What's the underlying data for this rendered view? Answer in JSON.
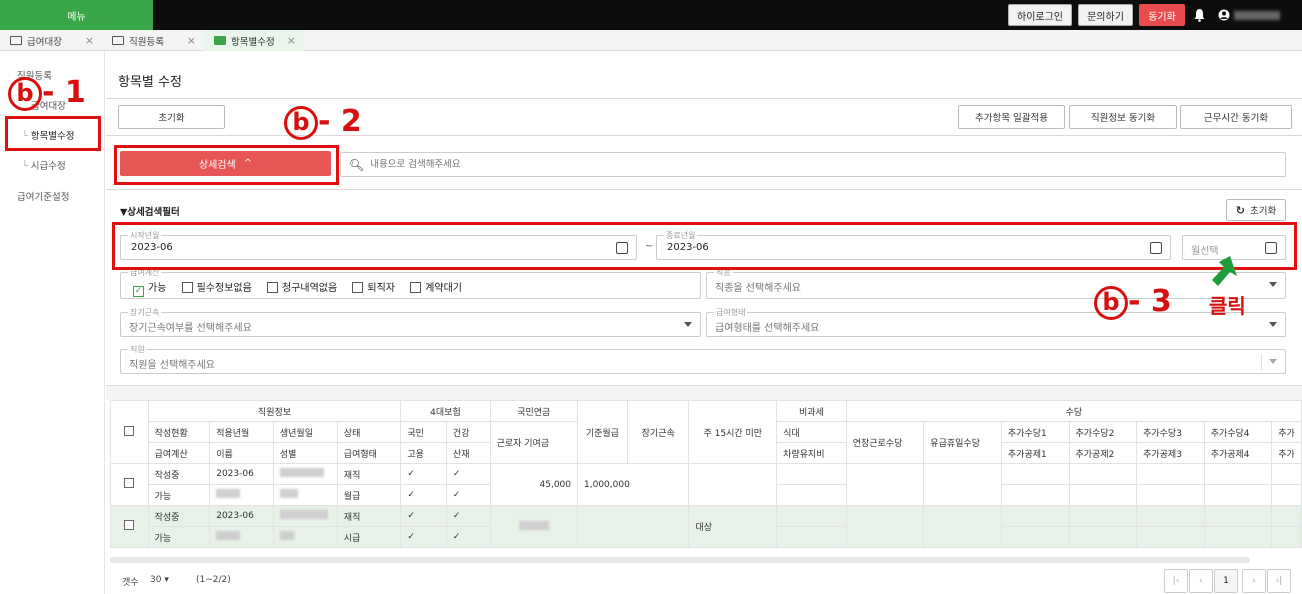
{
  "topbar": {
    "menu_label": "메뉴",
    "btn_hi": "하이로그인",
    "btn_inquiry": "문의하기",
    "btn_sync": "동기화",
    "bell_icon": "bell-icon",
    "user_icon": "user-icon"
  },
  "tabs": [
    {
      "label": "급여대장",
      "icon": "list-icon"
    },
    {
      "label": "직원등록",
      "icon": "id-card-icon"
    },
    {
      "label": "항목별수정",
      "icon": "money-icon"
    }
  ],
  "tab_close": "×",
  "sidebar": {
    "items": [
      "직원등록",
      "급여대장",
      "항목별수정",
      "시급수정",
      "급여기준설정"
    ]
  },
  "annotations": {
    "b": "b",
    "n1": "- 1",
    "n2": "- 2",
    "n3": "- 3",
    "click": "클릭",
    "color": "#e01010",
    "arrow_color": "#1f9d3a"
  },
  "page": {
    "title": "항목별 수정",
    "reset_btn": "초기화",
    "btn_add_items": "추가항목 일괄적용",
    "btn_emp_sync": "직원정보 동기화",
    "btn_work_sync": "근무시간 동기화",
    "detail_search": "상세검색",
    "search_placeholder": "내용으로 검색해주세요",
    "filter_title": "▼상세검색필터",
    "filter_reset": "초기화"
  },
  "filters": {
    "start_label": "시작년월",
    "start_value": "2023-06",
    "tilde": "~",
    "end_label": "종료년월",
    "end_value": "2023-06",
    "month_placeholder": "월선택",
    "calc_label": "급여계산",
    "checks": [
      {
        "label": "가능",
        "checked": true
      },
      {
        "label": "필수정보없음",
        "checked": false
      },
      {
        "label": "청구내역없음",
        "checked": false
      },
      {
        "label": "퇴직자",
        "checked": false
      },
      {
        "label": "계약대기",
        "checked": false
      }
    ],
    "job_label": "직종",
    "job_placeholder": "직종을 선택해주세요",
    "long_label": "장기근속",
    "long_placeholder": "장기근속여부를 선택해주세요",
    "paytype_label": "급여형태",
    "paytype_placeholder": "급여형태를 선택해주세요",
    "emp_label": "직원",
    "emp_placeholder": "직원을 선택해주세요"
  },
  "table": {
    "group_headers": {
      "emp_info": "직원정보",
      "insurance": "4대보험",
      "pension": "국민연금",
      "nontax": "비과세",
      "allowance": "수당"
    },
    "h1": [
      "작성현황",
      "적용년월",
      "생년월일",
      "상태",
      "국민",
      "건강"
    ],
    "h2": [
      "급여계산",
      "이름",
      "성별",
      "급여형태",
      "고용",
      "산재"
    ],
    "col_worker": "근로자 기여금",
    "col_base": "기준월급",
    "col_long": "장기근속",
    "col_15h": "주 15시간 미만",
    "col_meal": "식대",
    "col_car": "차량유지비",
    "col_overtime": "연장근로수당",
    "col_holiday": "유급휴일수당",
    "add_allow": [
      "추가수당1",
      "추가수당2",
      "추가수당3",
      "추가수당4",
      "추가"
    ],
    "add_deduct": [
      "추가공제1",
      "추가공제2",
      "추가공제3",
      "추가공제4",
      "추가"
    ],
    "rows": [
      {
        "status": "작성중",
        "ym": "2023-06",
        "state": "재직",
        "c1": "✓",
        "c2": "✓",
        "calc": "가능",
        "paytype": "월급",
        "c3": "✓",
        "c4": "✓",
        "worker": "45,000",
        "base": "1,000,000",
        "u15": ""
      },
      {
        "status": "작성중",
        "ym": "2023-06",
        "state": "재직",
        "c1": "✓",
        "c2": "✓",
        "calc": "가능",
        "paytype": "시급",
        "c3": "✓",
        "c4": "✓",
        "worker": "",
        "base": "",
        "u15": "대상"
      }
    ]
  },
  "footer": {
    "count_label": "갯수",
    "count_value": "30 ▾",
    "range": "(1~2/2)",
    "first": "|‹",
    "prev": "‹",
    "page": "1",
    "next": "›",
    "last": "›|"
  }
}
